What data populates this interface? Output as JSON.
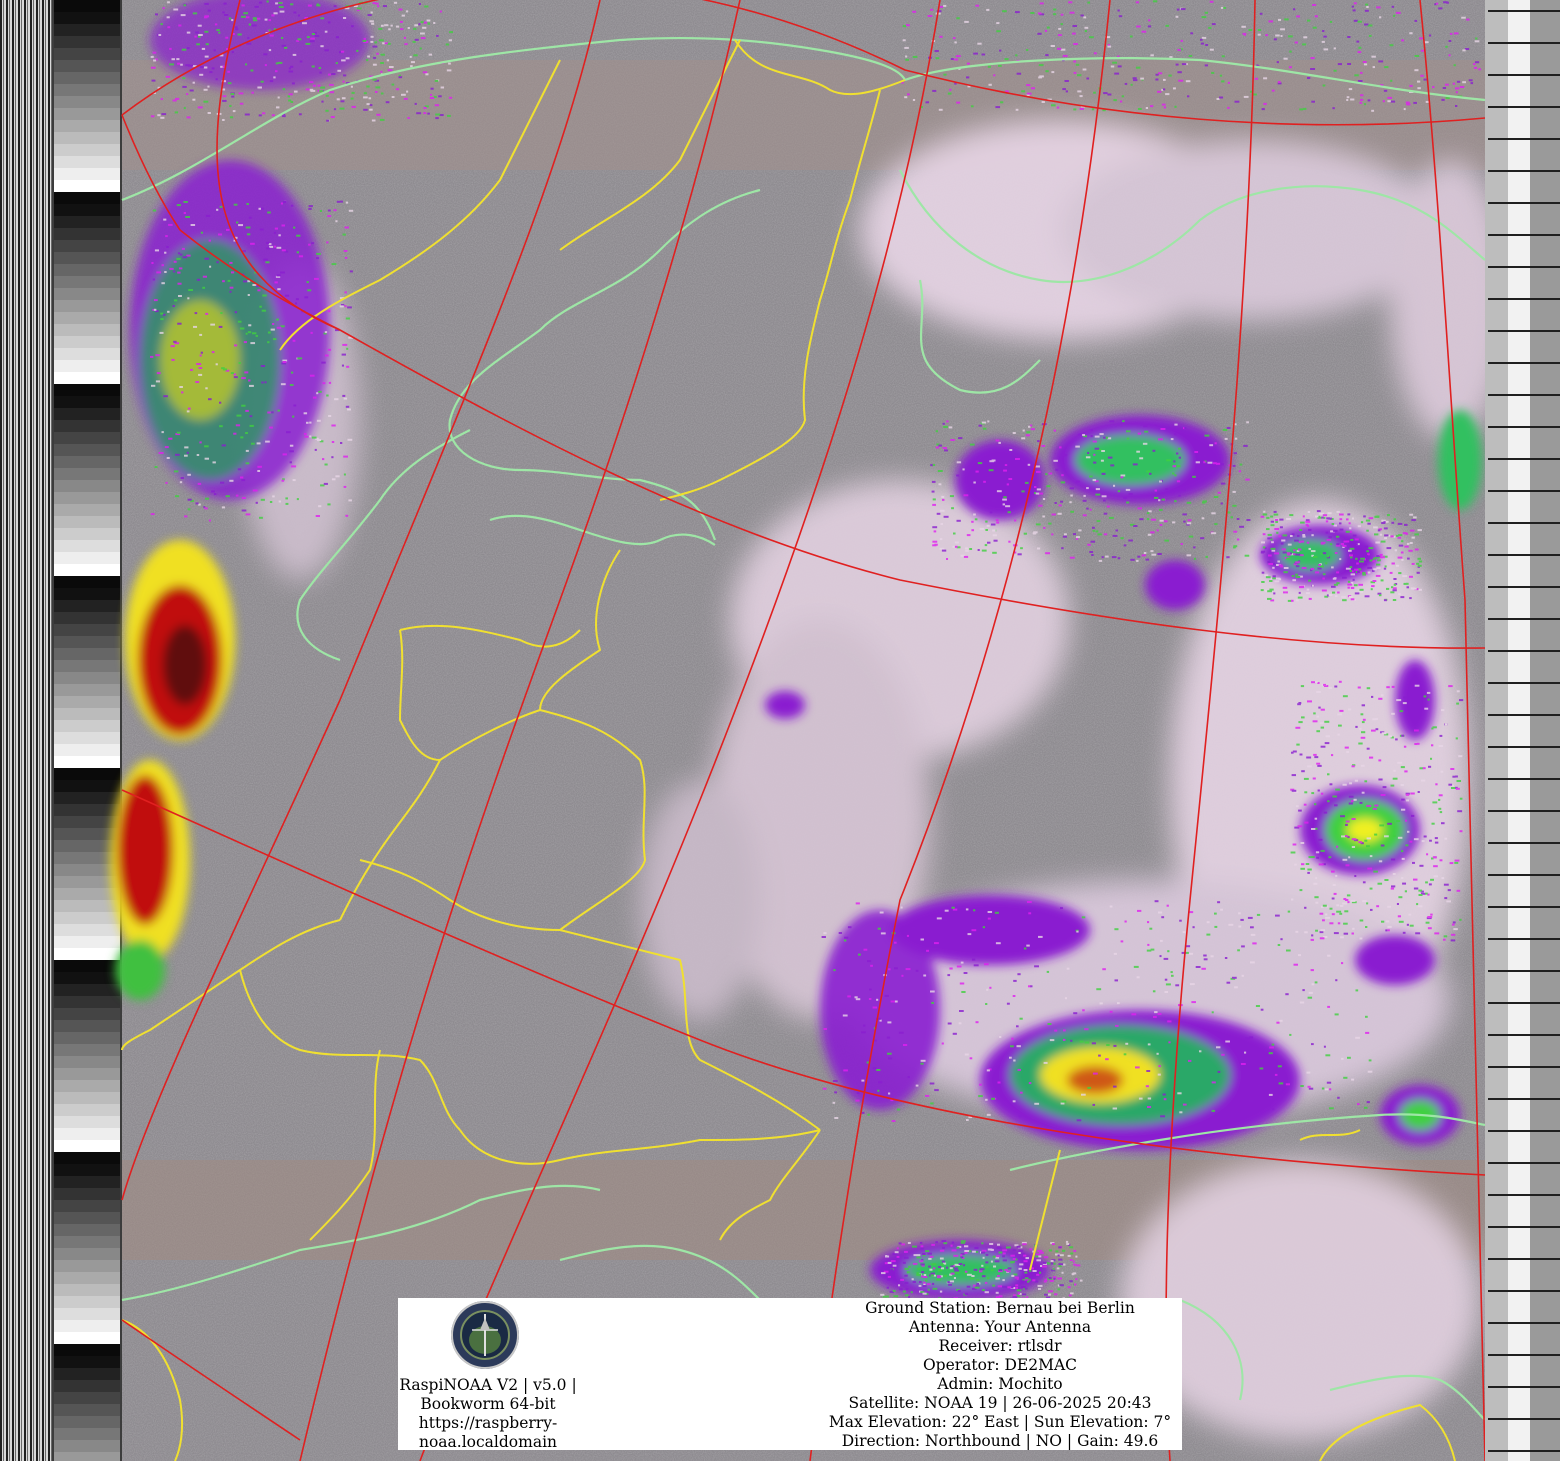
{
  "image": {
    "kind": "NOAA APT satellite weather image (false-color MCIR)",
    "colors": {
      "cloud_light": "#e8d6e6",
      "land_gray": "#8e8b90",
      "grid_line": "#e02020",
      "border_yellow": "#f0e030",
      "coast_green": "#9ee6a6",
      "precip_purple": "#8a1fd0",
      "precip_magenta": "#e020f0",
      "precip_green": "#40d040",
      "precip_yellow": "#f0f020",
      "precip_red": "#c01010",
      "precip_darkred": "#600808"
    }
  },
  "overlay": {
    "logo_icon": "raspinoaa-satellite-logo-icon",
    "left_lines": [
      "RaspiNOAA V2 | v5.0 |",
      "Bookworm 64-bit",
      "https://raspberry-",
      "noaa.localdomain"
    ],
    "right_lines": [
      "Ground Station: Bernau bei Berlin",
      "Antenna: Your Antenna",
      "Receiver: rtlsdr",
      "Operator: DE2MAC",
      "Admin: Mochito",
      "Satellite: NOAA 19 | 26-06-2025 20:43",
      "Max Elevation: 22° East | Sun Elevation: 7°",
      "Direction: Northbound | NO | Gain: 49.6"
    ]
  }
}
